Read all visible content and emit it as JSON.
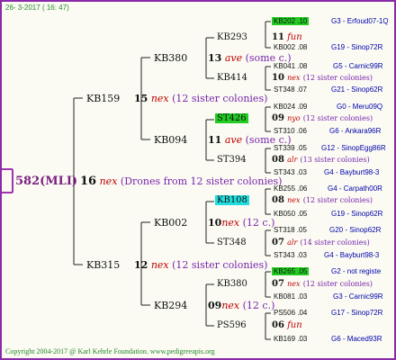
{
  "header": {
    "date": "26- 3-2017",
    "time": "( 16: 47)"
  },
  "footer": {
    "copyright": "Copyright 2004-2017 @ Karl Kehrle Foundation.",
    "site": "www.pedigreeapis.org"
  },
  "root": {
    "id": "582(MLI)",
    "num": "16",
    "tag": "nex",
    "desc": "(Drones from 12 sister colonies)"
  },
  "gen1": [
    {
      "id": "KB159",
      "num": "15",
      "tag": "nex",
      "desc": "(12 sister colonies)"
    },
    {
      "id": "KB315",
      "num": "12",
      "tag": "nex",
      "desc": "(12 sister colonies)"
    }
  ],
  "gen2": [
    {
      "id": "KB380",
      "num": "13",
      "tag": "ave",
      "desc": "(some c.)"
    },
    {
      "id": "KB094",
      "num": "11",
      "tag": "ave",
      "desc": "(some c.)"
    },
    {
      "id": "KB002",
      "num": "10",
      "tag": "nex",
      "desc": "(12 c.)"
    },
    {
      "id": "KB294",
      "num": "09",
      "tag": "nex",
      "desc": "(12 c.)"
    }
  ],
  "gen3": [
    {
      "id": "KB293",
      "num": "11",
      "tag": "fun",
      "desc": ""
    },
    {
      "id": "KB414",
      "num": "10",
      "tag": "nex",
      "desc": "(12 sister colonies)"
    },
    {
      "id": "ST426",
      "num": "09",
      "tag": "nyo",
      "desc": "(12 sister colonies)"
    },
    {
      "id": "ST394",
      "num": "08",
      "tag": "alr",
      "desc": "(13 sister colonies)"
    },
    {
      "id": "KB108",
      "num": "08",
      "tag": "nex",
      "desc": "(12 sister colonies)"
    },
    {
      "id": "ST348",
      "num": "07",
      "tag": "alr",
      "desc": "(14 sister colonies)"
    },
    {
      "id": "KB380",
      "num": "07",
      "tag": "nex",
      "desc": "(12 sister colonies)"
    },
    {
      "id": "PS596",
      "num": "06",
      "tag": "fun",
      "desc": ""
    }
  ],
  "gen4": [
    {
      "id": "KB202 .10",
      "info": "G3 - Erfoud07-1Q"
    },
    {
      "id": "KB002 .08",
      "info": "G19 - Sinop72R"
    },
    {
      "id": "KB041 .08",
      "info": "G5 - Carnic99R"
    },
    {
      "id": "ST348 .07",
      "info": "G21 - Sinop62R"
    },
    {
      "id": "KB024 .09",
      "info": "G0 - Meru09Q"
    },
    {
      "id": "ST310 .06",
      "info": "G6 - Ankara96R"
    },
    {
      "id": "ST339 .05",
      "info": "G12 - SinopEgg86R"
    },
    {
      "id": "ST343 .03",
      "info": "G4 - Bayburt98-3"
    },
    {
      "id": "KB255 .06",
      "info": "G4 - Carpath00R"
    },
    {
      "id": "KB050 .05",
      "info": "G19 - Sinop62R"
    },
    {
      "id": "ST318 .05",
      "info": "G20 - Sinop62R"
    },
    {
      "id": "ST343 .03",
      "info": "G4 - Bayburt98-3"
    },
    {
      "id": "KB265 .05",
      "info": "G2 - not registe"
    },
    {
      "id": "KB081 .03",
      "info": "G3 - Carnic99R"
    },
    {
      "id": "PS506 .04",
      "info": "G17 - Sinop72R"
    },
    {
      "id": "KB169 .03",
      "info": "G6 - Maced93R"
    }
  ]
}
